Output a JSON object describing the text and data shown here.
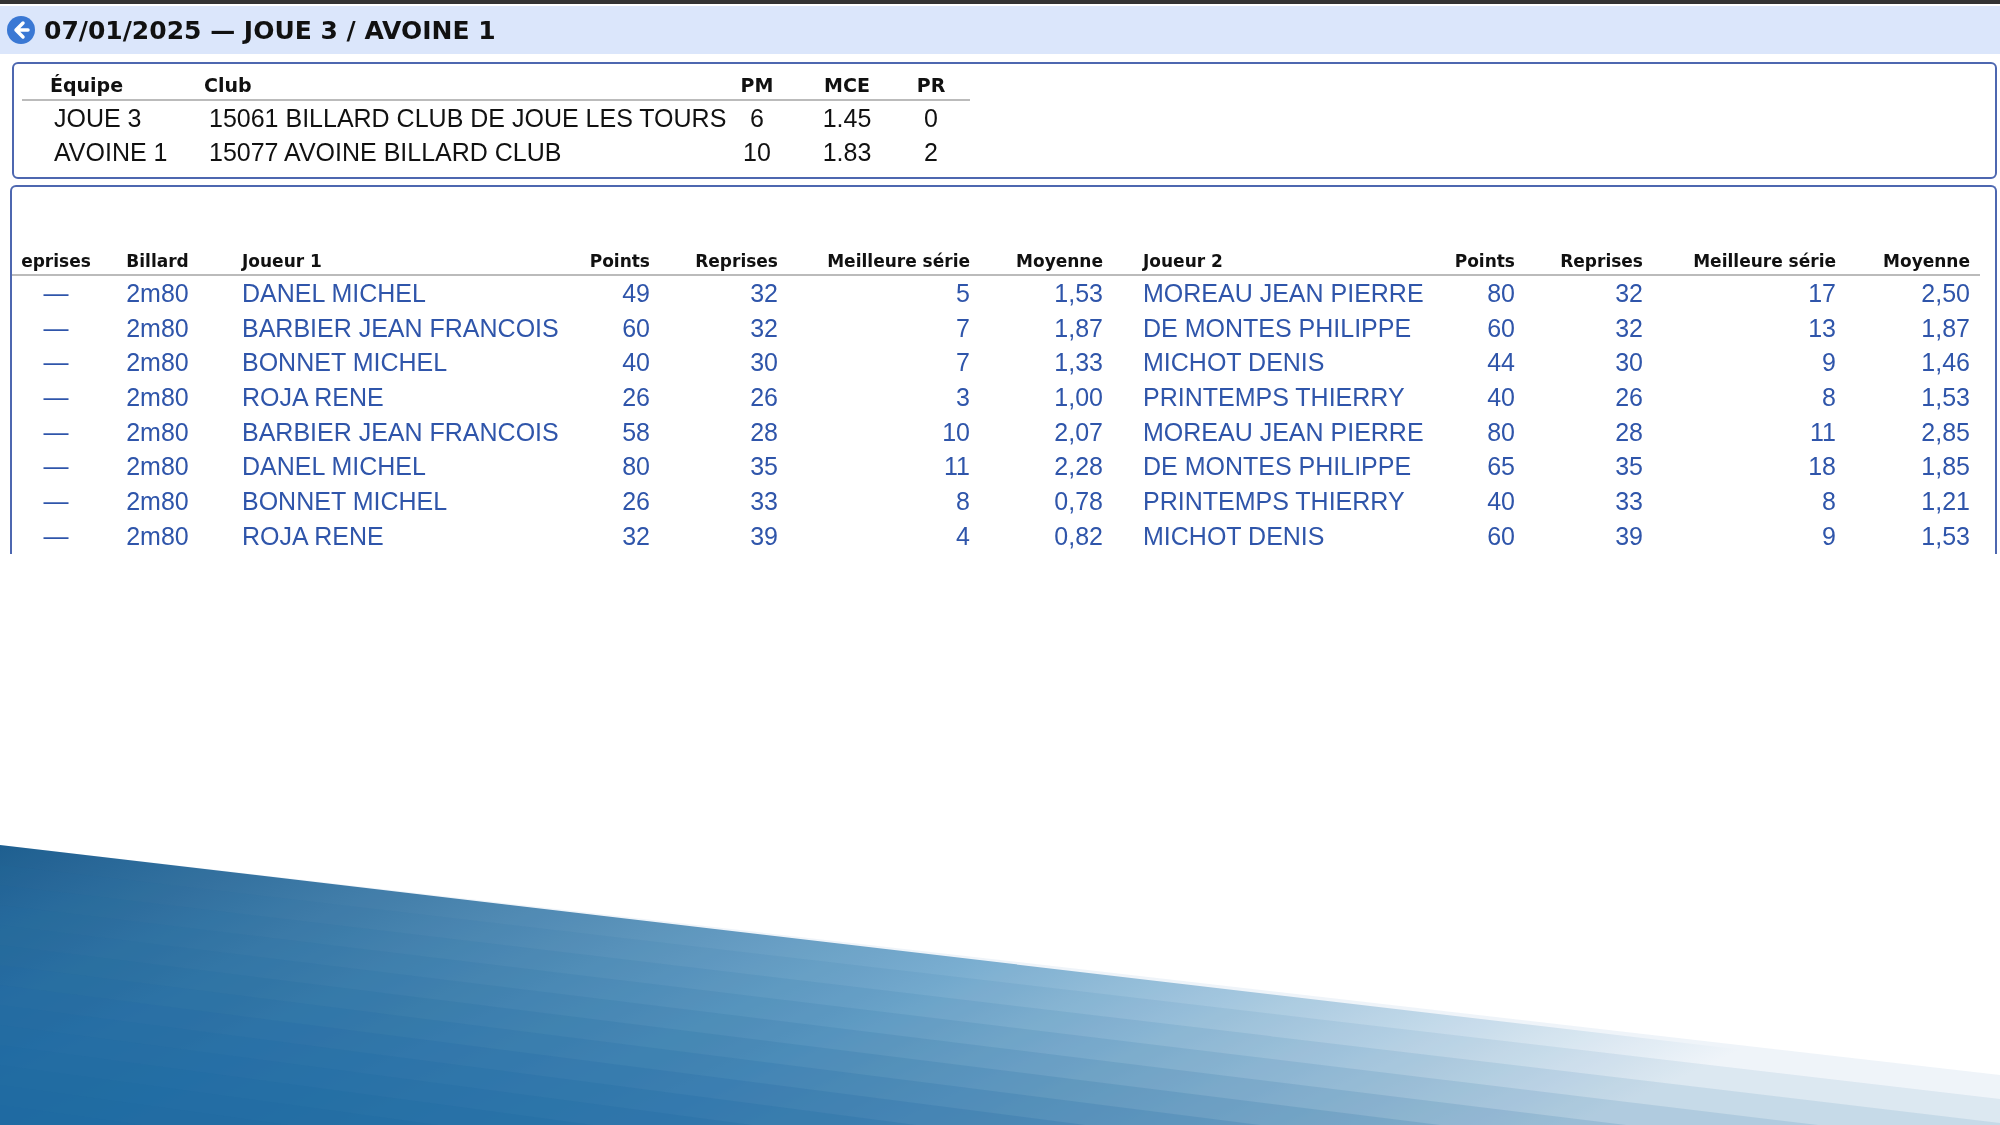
{
  "header": {
    "title": "07/01/2025 — JOUE 3 / AVOINE 1"
  },
  "summary": {
    "columns": [
      {
        "label": "Équipe",
        "kind": "text"
      },
      {
        "label": "Club",
        "kind": "text"
      },
      {
        "label": "PM",
        "kind": "number"
      },
      {
        "label": "MCE",
        "kind": "number"
      },
      {
        "label": "PR",
        "kind": "number"
      }
    ],
    "rows": [
      [
        "JOUE 3",
        "15061 BILLARD CLUB DE JOUE LES TOURS",
        "6",
        "1.45",
        "0"
      ],
      [
        "AVOINE 1",
        "15077 AVOINE BILLARD CLUB",
        "10",
        "1.83",
        "2"
      ]
    ]
  },
  "results": {
    "columns": [
      {
        "label": "eprises",
        "kind": "center"
      },
      {
        "label": "Billard",
        "kind": "center"
      },
      {
        "label": "Joueur 1",
        "kind": "text"
      },
      {
        "label": "Points",
        "kind": "number"
      },
      {
        "label": "Reprises",
        "kind": "number"
      },
      {
        "label": "Meilleure série",
        "kind": "number"
      },
      {
        "label": "Moyenne",
        "kind": "number"
      },
      {
        "label": "Joueur 2",
        "kind": "text"
      },
      {
        "label": "Points",
        "kind": "number"
      },
      {
        "label": "Reprises",
        "kind": "number"
      },
      {
        "label": "Meilleure série",
        "kind": "number"
      },
      {
        "label": "Moyenne",
        "kind": "number"
      }
    ],
    "rows": [
      [
        "—",
        "2m80",
        "DANEL MICHEL",
        "49",
        "32",
        "5",
        "1,53",
        "MOREAU JEAN PIERRE",
        "80",
        "32",
        "17",
        "2,50"
      ],
      [
        "—",
        "2m80",
        "BARBIER JEAN FRANCOIS",
        "60",
        "32",
        "7",
        "1,87",
        "DE MONTES PHILIPPE",
        "60",
        "32",
        "13",
        "1,87"
      ],
      [
        "—",
        "2m80",
        "BONNET MICHEL",
        "40",
        "30",
        "7",
        "1,33",
        "MICHOT DENIS",
        "44",
        "30",
        "9",
        "1,46"
      ],
      [
        "—",
        "2m80",
        "ROJA RENE",
        "26",
        "26",
        "3",
        "1,00",
        "PRINTEMPS THIERRY",
        "40",
        "26",
        "8",
        "1,53"
      ],
      [
        "—",
        "2m80",
        "BARBIER JEAN FRANCOIS",
        "58",
        "28",
        "10",
        "2,07",
        "MOREAU JEAN PIERRE",
        "80",
        "28",
        "11",
        "2,85"
      ],
      [
        "—",
        "2m80",
        "DANEL MICHEL",
        "80",
        "35",
        "11",
        "2,28",
        "DE MONTES PHILIPPE",
        "65",
        "35",
        "18",
        "1,85"
      ],
      [
        "—",
        "2m80",
        "BONNET MICHEL",
        "26",
        "33",
        "8",
        "0,78",
        "PRINTEMPS THIERRY",
        "40",
        "33",
        "8",
        "1,21"
      ],
      [
        "—",
        "2m80",
        "ROJA RENE",
        "32",
        "39",
        "4",
        "0,82",
        "MICHOT DENIS",
        "60",
        "39",
        "9",
        "1,53"
      ]
    ]
  }
}
